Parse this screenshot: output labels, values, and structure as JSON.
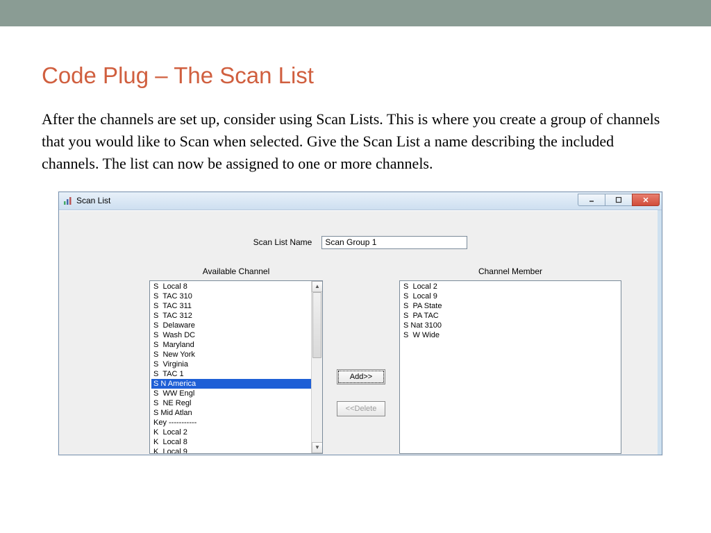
{
  "slide": {
    "title": "Code Plug – The Scan List",
    "body": "After the channels are set up, consider using Scan Lists. This is where you create a group of channels that you would like to Scan when selected.  Give the Scan List a name describing the included channels. The list can now be assigned to one or more channels."
  },
  "window": {
    "title": "Scan List",
    "name_label": "Scan List Name",
    "name_value": "Scan Group 1",
    "available_label": "Available Channel",
    "member_label": "Channel Member",
    "add_button": "Add>>",
    "delete_button": "<<Delete",
    "available_channels": [
      "S  Local 8",
      "S  TAC 310",
      "S  TAC 311",
      "S  TAC 312",
      "S  Delaware",
      "S  Wash DC",
      "S  Maryland",
      "S  New York",
      "S  Virginia",
      "S  TAC 1",
      "S N America",
      "S  WW Engl",
      "S  NE Regl",
      "S Mid Atlan",
      "Key -----------",
      "K  Local 2",
      "K  Local 8",
      "K  Local 9"
    ],
    "available_selected_index": 10,
    "member_channels": [
      "S  Local 2",
      "S  Local 9",
      "S  PA State",
      "S  PA TAC",
      "S Nat 3100",
      "S  W Wide"
    ]
  }
}
